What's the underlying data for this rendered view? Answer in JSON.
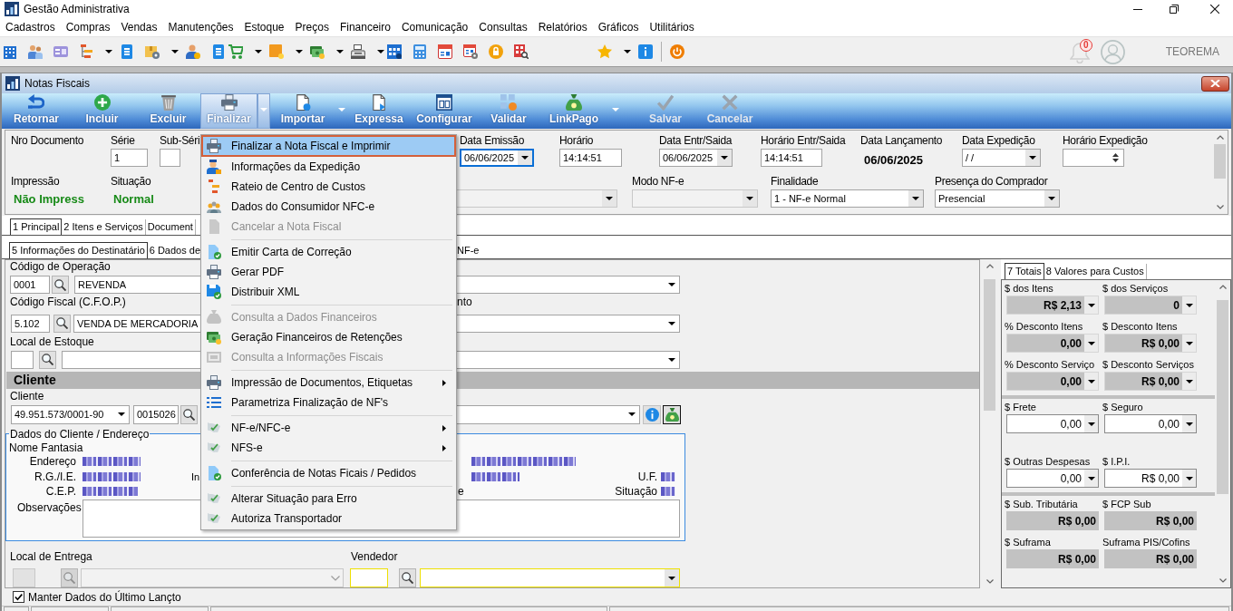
{
  "window": {
    "title": "Gestão Administrativa"
  },
  "menu_bar": [
    "Cadastros",
    "Compras",
    "Vendas",
    "Manutenções",
    "Estoque",
    "Preços",
    "Financeiro",
    "Comunicação",
    "Consultas",
    "Relatórios",
    "Gráficos",
    "Utilitários"
  ],
  "toolbar": {
    "notification_count": "0",
    "user_name": "TEOREMA"
  },
  "document_window": {
    "title": "Notas Fiscais"
  },
  "ribbon": [
    {
      "label": "Retornar",
      "active": false,
      "disabled": false,
      "dropdown": false
    },
    {
      "label": "Incluir",
      "active": false,
      "disabled": false,
      "dropdown": false
    },
    {
      "label": "Excluir",
      "active": false,
      "disabled": false,
      "dropdown": false
    },
    {
      "label": "Finalizar",
      "active": true,
      "disabled": false,
      "dropdown": true
    },
    {
      "label": "Importar",
      "active": false,
      "disabled": false,
      "dropdown": true
    },
    {
      "label": "Expressa",
      "active": false,
      "disabled": false,
      "dropdown": false
    },
    {
      "label": "Configurar",
      "active": false,
      "disabled": false,
      "dropdown": false
    },
    {
      "label": "Validar",
      "active": false,
      "disabled": false,
      "dropdown": false
    },
    {
      "label": "LinkPago",
      "active": false,
      "disabled": false,
      "dropdown": true
    },
    {
      "label": "Salvar",
      "active": false,
      "disabled": true,
      "dropdown": false
    },
    {
      "label": "Cancelar",
      "active": false,
      "disabled": true,
      "dropdown": false
    }
  ],
  "header": {
    "top_fields": [
      {
        "label": "Nro Documento",
        "kind": "label"
      },
      {
        "label": "Série",
        "kind": "input",
        "value": "1"
      },
      {
        "label": "Sub-Séri",
        "kind": "input"
      },
      {
        "label": "Data Emissão",
        "kind": "date",
        "value": "06/06/2025",
        "focused": true
      },
      {
        "label": "Horário",
        "kind": "input",
        "value": "14:14:51"
      },
      {
        "label": "Data Entr/Saida",
        "kind": "date",
        "value": "06/06/2025",
        "focused": false
      },
      {
        "label": "Horário Entr/Saida",
        "kind": "input",
        "value": "14:14:51"
      },
      {
        "label": "Data Lançamento",
        "kind": "text",
        "value": "06/06/2025"
      },
      {
        "label": "Data Expedição",
        "kind": "date",
        "value": "/ /",
        "focused": false
      },
      {
        "label": "Horário Expedição",
        "kind": "spin"
      }
    ],
    "bottom_fields": [
      {
        "label": "Impressão",
        "kind": "status",
        "value": "Não Impress"
      },
      {
        "label": "Situação",
        "kind": "status",
        "value": "Normal"
      },
      {
        "kind": "select",
        "disabled": true
      },
      {
        "label": "Modo NF-e",
        "kind": "select",
        "disabled": true
      },
      {
        "label": "Finalidade",
        "kind": "select",
        "value": "1 - NF-e Normal",
        "disabled": false
      },
      {
        "label": "Presença do Comprador",
        "kind": "select",
        "value": "Presencial",
        "disabled": false
      }
    ]
  },
  "tabs": [
    {
      "label": "1 Principal",
      "selected": true
    },
    {
      "label": "2 Itens e Serviços",
      "selected": false
    },
    {
      "label": "Document",
      "selected": false
    }
  ],
  "subtabs": [
    {
      "label": "5 Informações do Destinatário",
      "selected": true
    },
    {
      "label": "6 Dados de",
      "selected": false
    }
  ],
  "subtab_tail": "NF-e",
  "form": {
    "operation": {
      "label": "Código de Operação",
      "code": "0001",
      "description": "REVENDA"
    },
    "cfop": {
      "label": "Código Fiscal (C.F.O.P.)",
      "side_label_tail": "nto",
      "code": "5.102",
      "description": "VENDA DE MERCADORIA"
    },
    "stock": {
      "label": "Local de Estoque"
    },
    "section_title": "Cliente",
    "client": {
      "label": "Cliente",
      "document": "49.951.573/0001-90",
      "code": "0015026"
    },
    "address": {
      "title": "Dados do Cliente / Endereço",
      "name_label": "Nome Fantasia",
      "rows": [
        {
          "label": "Endereço"
        },
        {
          "label": "R.G./I.E.",
          "covered_label": "In",
          "right_label": "U.F."
        },
        {
          "label": "C.E.P.",
          "middle_label_tail": "e",
          "right_label": "Situação"
        }
      ],
      "notes_label": "Observações"
    },
    "delivery": {
      "label": "Local de Entrega",
      "disabled": true
    },
    "seller": {
      "label": "Vendedor",
      "highlighted": true
    }
  },
  "totals": {
    "tabs": [
      {
        "label": "7 Totais",
        "selected": true
      },
      {
        "label": "8 Valores para Custos",
        "selected": false
      }
    ],
    "groups": [
      {
        "fields": [
          {
            "label": "$ dos Itens",
            "value": "R$ 2,13",
            "kind": "total"
          },
          {
            "label": "$ dos Serviços",
            "value": "0",
            "kind": "total"
          },
          {
            "label": "% Desconto Itens",
            "value": "0,00",
            "kind": "total"
          },
          {
            "label": "$ Desconto Itens",
            "value": "R$ 0,00",
            "kind": "total"
          },
          {
            "label": "% Desconto Serviço",
            "value": "0,00",
            "kind": "total"
          },
          {
            "label": "$ Desconto Serviços",
            "value": "R$ 0,00",
            "kind": "total"
          }
        ]
      },
      {
        "fields": [
          {
            "label": "$ Frete",
            "value": "0,00",
            "kind": "input"
          },
          {
            "label": "$ Seguro",
            "value": "0,00",
            "kind": "input"
          },
          {
            "label": "$ Outras Despesas",
            "value": "0,00",
            "kind": "input"
          },
          {
            "label": "$ I.P.I.",
            "value": "R$ 0,00",
            "kind": "input"
          }
        ]
      },
      {
        "fields": [
          {
            "label": "$ Sub. Tributária",
            "value": "R$ 0,00",
            "kind": "readonly"
          },
          {
            "label": "$ FCP Sub",
            "value": "R$ 0,00",
            "kind": "readonly"
          },
          {
            "label": "$ Suframa",
            "value": "R$ 0,00",
            "kind": "readonly"
          },
          {
            "label": "Suframa PIS/Cofins",
            "value": "R$ 0,00",
            "kind": "readonly"
          }
        ]
      }
    ]
  },
  "footer": {
    "checkbox": {
      "label": "Manter Dados do Último Lançto",
      "checked": true
    }
  },
  "context_menu": {
    "sections": [
      {
        "items": [
          {
            "label": "Finalizar a Nota Fiscal e Imprimir",
            "selected": true,
            "disabled": false,
            "submenu": false
          },
          {
            "label": "Informações da Expedição",
            "selected": false,
            "disabled": false,
            "submenu": false
          },
          {
            "label": "Rateio de Centro de Custos",
            "selected": false,
            "disabled": false,
            "submenu": false
          },
          {
            "label": "Dados do Consumidor NFC-e",
            "selected": false,
            "disabled": false,
            "submenu": false
          },
          {
            "label": "Cancelar a Nota Fiscal",
            "selected": false,
            "disabled": true,
            "submenu": false
          }
        ]
      },
      {
        "items": [
          {
            "label": "Emitir Carta de Correção",
            "selected": false,
            "disabled": false,
            "submenu": false
          },
          {
            "label": "Gerar PDF",
            "selected": false,
            "disabled": false,
            "submenu": false
          },
          {
            "label": "Distribuir XML",
            "selected": false,
            "disabled": false,
            "submenu": false
          }
        ]
      },
      {
        "items": [
          {
            "label": "Consulta a Dados Financeiros",
            "selected": false,
            "disabled": true,
            "submenu": false
          },
          {
            "label": "Geração Financeiros de Retenções",
            "selected": false,
            "disabled": false,
            "submenu": false
          },
          {
            "label": "Consulta a Informações Fiscais",
            "selected": false,
            "disabled": true,
            "submenu": false
          }
        ]
      },
      {
        "items": [
          {
            "label": "Impressão de Documentos, Etiquetas",
            "selected": false,
            "disabled": false,
            "submenu": true
          },
          {
            "label": "Parametriza Finalização de NF's",
            "selected": false,
            "disabled": false,
            "submenu": false
          }
        ]
      },
      {
        "items": [
          {
            "label": "NF-e/NFC-e",
            "selected": false,
            "disabled": false,
            "submenu": true
          },
          {
            "label": "NFS-e",
            "selected": false,
            "disabled": false,
            "submenu": true
          }
        ]
      },
      {
        "items": [
          {
            "label": "Conferência de Notas Ficais / Pedidos",
            "selected": false,
            "disabled": false,
            "submenu": false
          }
        ]
      },
      {
        "items": [
          {
            "label": "Alterar Situação para Erro",
            "selected": false,
            "disabled": false,
            "submenu": false
          },
          {
            "label": "Autoriza Transportador",
            "selected": false,
            "disabled": false,
            "submenu": false
          }
        ]
      }
    ]
  }
}
